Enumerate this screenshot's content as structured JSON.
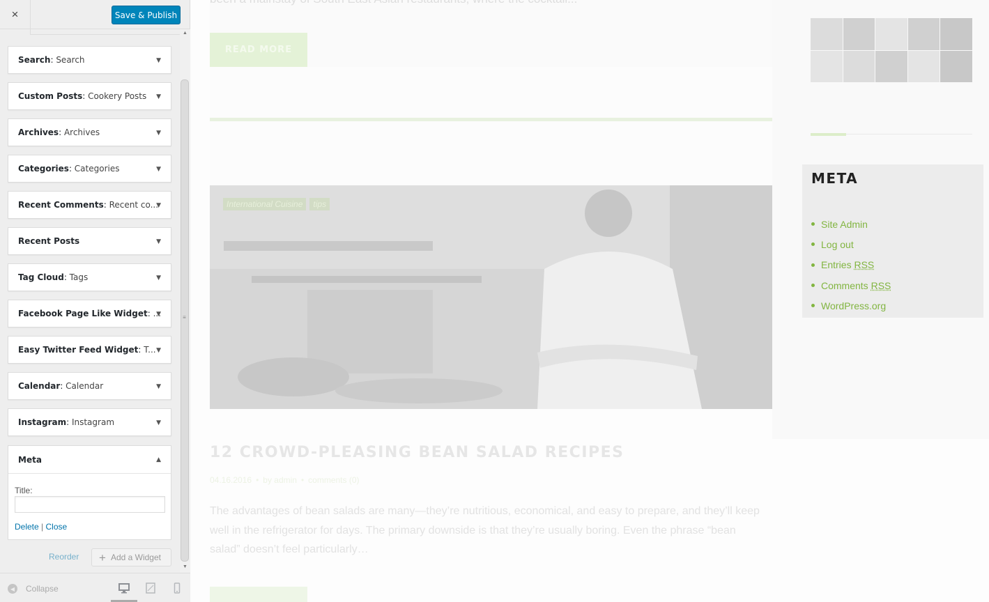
{
  "customizer": {
    "close_icon": "×",
    "save_label": "Save & Publish",
    "widgets": [
      {
        "type": "Search",
        "title": "Search"
      },
      {
        "type": "Custom Posts",
        "title": "Cookery Posts"
      },
      {
        "type": "Archives",
        "title": "Archives"
      },
      {
        "type": "Categories",
        "title": "Categories"
      },
      {
        "type": "Recent Comments",
        "title": "Recent co..."
      },
      {
        "type": "Recent Posts",
        "title": ""
      },
      {
        "type": "Tag Cloud",
        "title": "Tags"
      },
      {
        "type": "Facebook Page Like Widget",
        "title": "..."
      },
      {
        "type": "Easy Twitter Feed Widget",
        "title": "T..."
      },
      {
        "type": "Calendar",
        "title": "Calendar"
      },
      {
        "type": "Instagram",
        "title": "Instagram"
      }
    ],
    "meta_widget": {
      "type": "Meta",
      "title_label": "Title:",
      "title_value": "",
      "delete_label": "Delete",
      "close_label": "Close"
    },
    "reorder_label": "Reorder",
    "add_widget_label": "Add a Widget",
    "collapse_label": "Collapse",
    "devices": [
      "desktop-icon",
      "tablet-icon",
      "mobile-icon"
    ],
    "colors": {
      "primary_button": "#0085ba",
      "link": "#0073aa"
    }
  },
  "preview": {
    "top_excerpt": "been a mainstay of South East Asian restaurants, where the cocktail...",
    "read_more_label": "READ MORE",
    "post": {
      "tags": [
        "International Cuisine",
        "tips"
      ],
      "title": "12 CROWD-PLEASING BEAN SALAD RECIPES",
      "date": "04.16.2016",
      "author": "by admin",
      "comments": "comments (0)",
      "excerpt": "The advantages of bean salads are many—they’re nutritious, economical, and easy to prepare, and they’ll keep well in the refrigerator for days. The primary downside is that they’re usually boring. Even the phrase “bean salad” doesn’t feel particularly…"
    },
    "sidebar": {
      "meta_title": "META",
      "meta_links": [
        {
          "label": "Site Admin",
          "abbr": ""
        },
        {
          "label": "Log out",
          "abbr": ""
        },
        {
          "label": "Entries ",
          "abbr": "RSS"
        },
        {
          "label": "Comments ",
          "abbr": "RSS"
        },
        {
          "label": "WordPress.org",
          "abbr": ""
        }
      ],
      "accent_color": "#82b541"
    }
  }
}
